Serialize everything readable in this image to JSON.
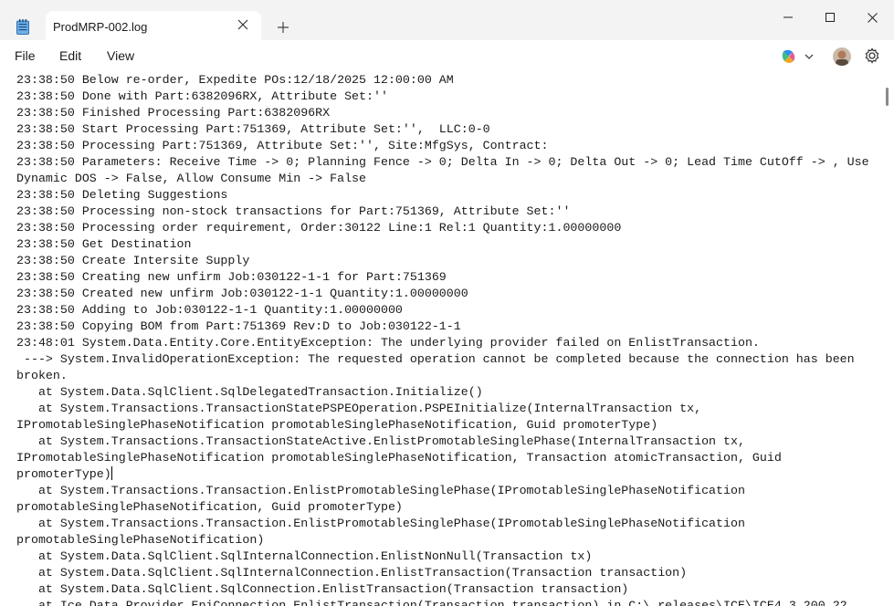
{
  "tab": {
    "title": "ProdMRP-002.log"
  },
  "menu": {
    "file": "File",
    "edit": "Edit",
    "view": "View"
  },
  "log_lines": [
    "23:38:50 Below re-order, Expedite POs:12/18/2025 12:00:00 AM",
    "23:38:50 Done with Part:6382096RX, Attribute Set:''",
    "23:38:50 Finished Processing Part:6382096RX",
    "23:38:50 Start Processing Part:751369, Attribute Set:'',  LLC:0-0",
    "23:38:50 Processing Part:751369, Attribute Set:'', Site:MfgSys, Contract:",
    "23:38:50 Parameters: Receive Time -> 0; Planning Fence -> 0; Delta In -> 0; Delta Out -> 0; Lead Time CutOff -> , Use",
    "Dynamic DOS -> False, Allow Consume Min -> False",
    "23:38:50 Deleting Suggestions",
    "23:38:50 Processing non-stock transactions for Part:751369, Attribute Set:''",
    "23:38:50 Processing order requirement, Order:30122 Line:1 Rel:1 Quantity:1.00000000",
    "23:38:50 Get Destination",
    "23:38:50 Create Intersite Supply",
    "23:38:50 Creating new unfirm Job:030122-1-1 for Part:751369",
    "23:38:50 Created new unfirm Job:030122-1-1 Quantity:1.00000000",
    "23:38:50 Adding to Job:030122-1-1 Quantity:1.00000000",
    "23:38:50 Copying BOM from Part:751369 Rev:D to Job:030122-1-1",
    "23:48:01 System.Data.Entity.Core.EntityException: The underlying provider failed on EnlistTransaction.",
    " ---> System.InvalidOperationException: The requested operation cannot be completed because the connection has been",
    "broken.",
    "   at System.Data.SqlClient.SqlDelegatedTransaction.Initialize()",
    "   at System.Transactions.TransactionStatePSPEOperation.PSPEInitialize(InternalTransaction tx,",
    "IPromotableSinglePhaseNotification promotableSinglePhaseNotification, Guid promoterType)",
    "   at System.Transactions.TransactionStateActive.EnlistPromotableSinglePhase(InternalTransaction tx,",
    "IPromotableSinglePhaseNotification promotableSinglePhaseNotification, Transaction atomicTransaction, Guid",
    "promoterType)",
    "   at System.Transactions.Transaction.EnlistPromotableSinglePhase(IPromotableSinglePhaseNotification",
    "promotableSinglePhaseNotification, Guid promoterType)",
    "   at System.Transactions.Transaction.EnlistPromotableSinglePhase(IPromotableSinglePhaseNotification",
    "promotableSinglePhaseNotification)",
    "   at System.Data.SqlClient.SqlInternalConnection.EnlistNonNull(Transaction tx)",
    "   at System.Data.SqlClient.SqlInternalConnection.EnlistTransaction(Transaction transaction)",
    "   at System.Data.SqlClient.SqlConnection.EnlistTransaction(Transaction transaction)",
    "   at Ice.Data.Provider.EpiConnection.EnlistTransaction(Transaction transaction) in C:\\_releases\\ICE\\ICE4.3.200.22"
  ],
  "caret_line": 24,
  "icons": {
    "app": "notepad-icon",
    "close_tab": "close-icon",
    "new_tab": "plus-icon",
    "minimize": "minimize-icon",
    "maximize": "maximize-icon",
    "close_window": "close-icon",
    "copilot": "copilot-icon",
    "dropdown": "chevron-down-icon",
    "avatar": "avatar",
    "settings": "gear-icon"
  },
  "colors": {
    "titlebar": "#f3f3f3",
    "tab": "#ffffff",
    "text": "#1a1a1a"
  }
}
